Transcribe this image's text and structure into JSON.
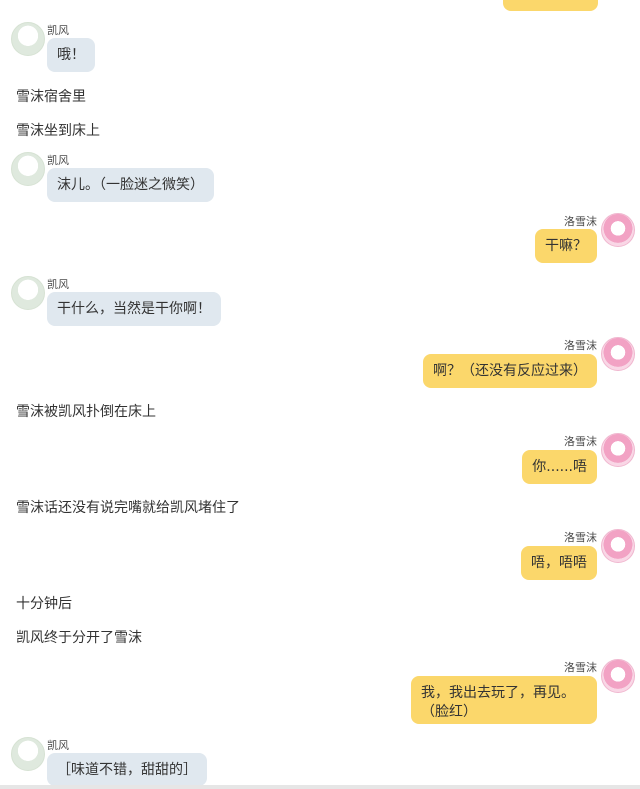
{
  "speakers": {
    "kaifeng": "凯风",
    "luoxuemo": "洛雪沫"
  },
  "messages": [
    {
      "type": "kai",
      "text": "哦！"
    },
    {
      "type": "narr",
      "text": "雪沫宿舍里"
    },
    {
      "type": "narr",
      "text": "雪沫坐到床上"
    },
    {
      "type": "kai",
      "text": "沫儿。（一脸迷之微笑）"
    },
    {
      "type": "luo",
      "text": "干嘛？"
    },
    {
      "type": "kai",
      "text": "干什么，当然是干你啊！"
    },
    {
      "type": "luo",
      "text": "啊？（还没有反应过来）"
    },
    {
      "type": "narr",
      "text": "雪沫被凯风扑倒在床上"
    },
    {
      "type": "luo",
      "text": "你......唔"
    },
    {
      "type": "narr",
      "text": "雪沫话还没有说完嘴就给凯风堵住了"
    },
    {
      "type": "luo",
      "text": "唔，唔唔"
    },
    {
      "type": "narr",
      "text": "十分钟后"
    },
    {
      "type": "narr",
      "text": "凯风终于分开了雪沫"
    },
    {
      "type": "luo",
      "text": "我，我出去玩了，再见。（脸红）"
    },
    {
      "type": "kai",
      "text": "［味道不错，甜甜的］"
    }
  ]
}
